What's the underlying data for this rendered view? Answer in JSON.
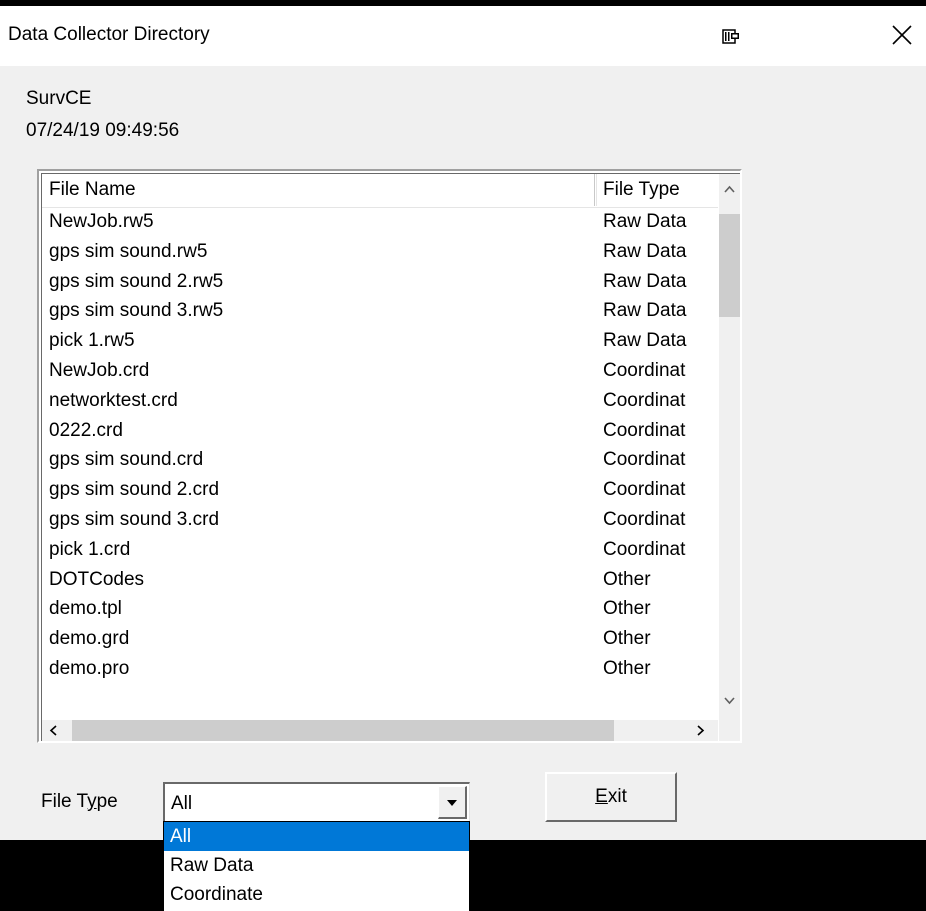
{
  "window": {
    "title": "Data Collector Directory"
  },
  "info": {
    "app_name": "SurvCE",
    "datetime": "07/24/19 09:49:56"
  },
  "list": {
    "columns": [
      "File Name",
      "File Type"
    ],
    "rows": [
      {
        "name": "NewJob.rw5",
        "type": "Raw Data"
      },
      {
        "name": "gps sim sound.rw5",
        "type": "Raw Data"
      },
      {
        "name": "gps sim sound 2.rw5",
        "type": "Raw Data"
      },
      {
        "name": "gps sim sound 3.rw5",
        "type": "Raw Data"
      },
      {
        "name": "pick 1.rw5",
        "type": "Raw Data"
      },
      {
        "name": "NewJob.crd",
        "type": "Coordinat"
      },
      {
        "name": "networktest.crd",
        "type": "Coordinat"
      },
      {
        "name": "0222.crd",
        "type": "Coordinat"
      },
      {
        "name": "gps sim sound.crd",
        "type": "Coordinat"
      },
      {
        "name": "gps sim sound 2.crd",
        "type": "Coordinat"
      },
      {
        "name": "gps sim sound 3.crd",
        "type": "Coordinat"
      },
      {
        "name": "pick 1.crd",
        "type": "Coordinat"
      },
      {
        "name": "DOTCodes",
        "type": "Other"
      },
      {
        "name": "demo.tpl",
        "type": "Other"
      },
      {
        "name": "demo.grd",
        "type": "Other"
      },
      {
        "name": "demo.pro",
        "type": "Other"
      }
    ]
  },
  "filter": {
    "label_before": "File T",
    "label_mnemonic": "y",
    "label_after": "pe",
    "selected": "All",
    "options": [
      "All",
      "Raw Data",
      "Coordinate"
    ],
    "highlighted_index": 0
  },
  "buttons": {
    "exit_mnemonic": "E",
    "exit_rest": "xit"
  },
  "colors": {
    "selection": "#0078d7",
    "window_bg": "#f0f0f0"
  },
  "icons": [
    "pin-icon",
    "close-icon",
    "scroll-up-icon",
    "scroll-down-icon",
    "scroll-left-icon",
    "scroll-right-icon",
    "dropdown-arrow-icon"
  ]
}
